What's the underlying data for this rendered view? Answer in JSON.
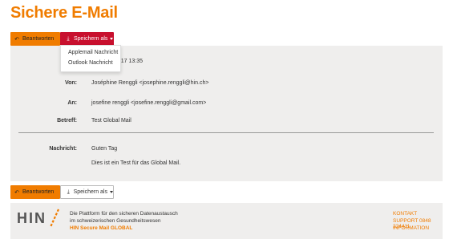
{
  "page": {
    "title": "Sichere E-Mail"
  },
  "toolbar_top": {
    "reply_label": "Beantworten",
    "save_label": "Speichern als"
  },
  "dropdown": {
    "items": [
      "Applemail Nachricht",
      "Outlook Nachricht"
    ]
  },
  "message": {
    "date_value": ".2017 13:35",
    "from_label": "Von:",
    "from_value": "Joséphine Renggli <josephine.renggli@hin.ch>",
    "to_label": "An:",
    "to_value": "josefine renggli <josefine.renggli@gmail.com>",
    "subject_label": "Betreff:",
    "subject_value": "Test Global Mail",
    "body_label": "Nachricht:",
    "body_lines": [
      "Guten Tag",
      "Dies ist ein Test für das Global Mail."
    ]
  },
  "toolbar_bottom": {
    "reply_label": "Beantworten",
    "save_label": "Speichern als"
  },
  "footer": {
    "logo_text": "HIN",
    "line1": "Die Plattform für den sicheren Datenaustausch",
    "line2": "im schweizerischen Gesundheitswesen",
    "brand": "HIN Secure Mail GLOBAL",
    "links": [
      "KONTAKT",
      "SUPPORT 0848 224411",
      "INFORMATION"
    ]
  },
  "colors": {
    "accent": "#f07c00",
    "danger": "#c8102e",
    "panel": "#efeeed"
  },
  "icons": {
    "reply": "reply-arrow-icon",
    "save": "download-icon",
    "caret": "caret-down-icon"
  }
}
